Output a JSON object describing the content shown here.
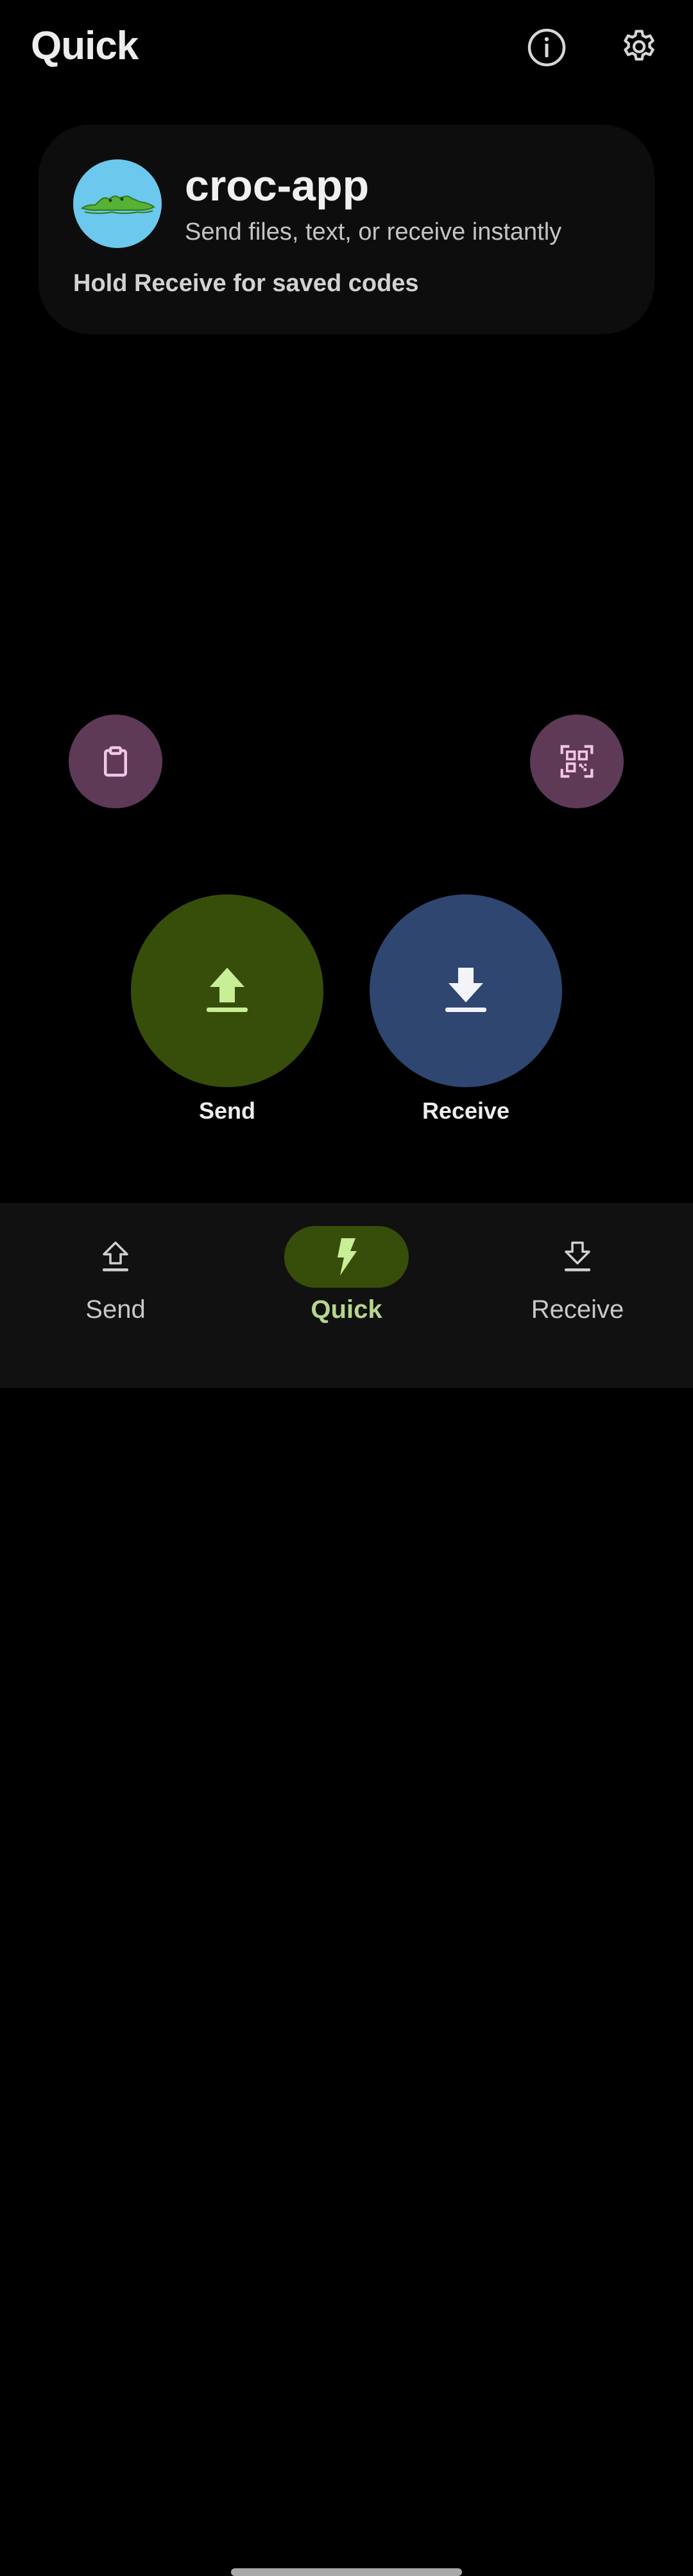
{
  "header": {
    "title": "Quick",
    "info_icon": "info-icon",
    "settings_icon": "gear-icon"
  },
  "card": {
    "app_name": "croc-app",
    "tagline": "Send files, text, or receive instantly",
    "hint": "Hold Receive for saved codes",
    "avatar_icon": "crocodile-logo"
  },
  "actions": {
    "clipboard_icon": "clipboard-icon",
    "qr_icon": "qr-scan-icon",
    "send_label": "Send",
    "receive_label": "Receive"
  },
  "nav": {
    "items": [
      {
        "label": "Send",
        "icon": "upload-icon",
        "active": false
      },
      {
        "label": "Quick",
        "icon": "bolt-icon",
        "active": true
      },
      {
        "label": "Receive",
        "icon": "download-icon",
        "active": false
      }
    ]
  },
  "colors": {
    "background": "#000000",
    "card": "#0D0D0D",
    "send_fab": "#374E0B",
    "receive_fab": "#2E4670",
    "mini_fab": "#5E3A57",
    "accent_green": "#B7D68C",
    "mini_fab_icon": "#F4C6E6",
    "avatar": "#6CC8EC"
  }
}
